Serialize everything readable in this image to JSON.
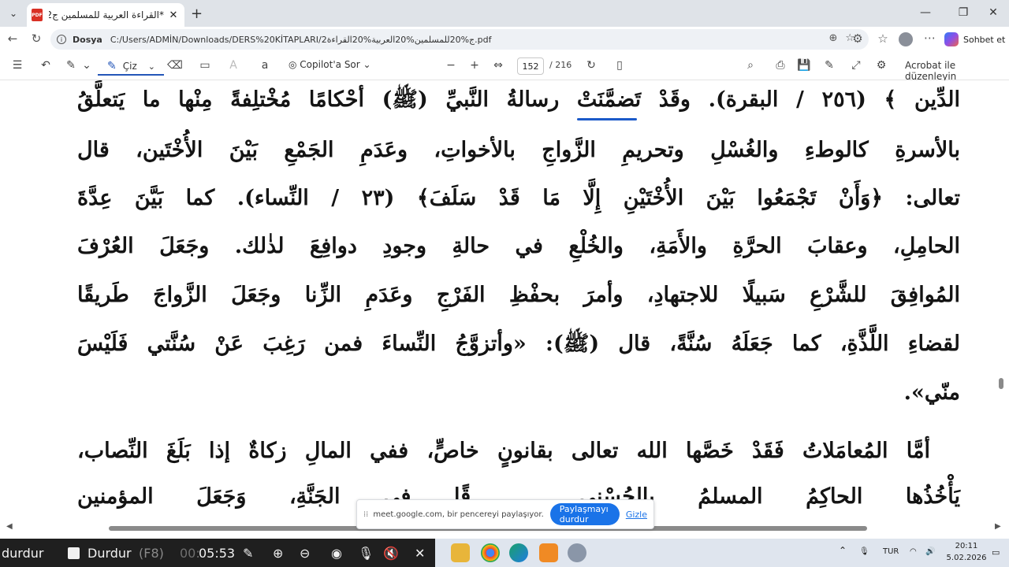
{
  "browser": {
    "tab_title": "*القراءة العربية للمسلمين ج2.pdf",
    "tab_favicon_label": "PDF",
    "address_scheme_label": "Dosya",
    "address_url": "C:/Users/ADMİN/Downloads/DERS%20KİTAPLARI/2ج%20للمسلمين%20العربية%20القراءة.pdf",
    "chat_label": "Sohbet et"
  },
  "pdf_toolbar": {
    "draw_label": "Çiz",
    "copilot_label": "Copilot'a Sor",
    "current_page": "152",
    "total_pages": "/ 216",
    "acrobat_label": "Acrobat ile düzenleyin"
  },
  "document": {
    "lines": [
      "الدِّين ﴾ (٢٥٦ / البقرة). وقَدْ تَضمَّنَتْ رسالةُ النَّبيِّ (ﷺ) أحْكامًا مُخْتلِفةً مِنْها ما يَتعلَّقُ",
      "بالأسرةِ كالوطءِ والغُسْلِ وتحريمِ الزَّواجِ بالأخواتِ، وعَدَمِ الجَمْعِ بَيْنَ الأُخْتَين، قال",
      "تعالى: ﴿وَأَنْ تَجْمَعُوا بَيْنَ الأُخْتَيْنِ إِلَّا مَا قَدْ سَلَفَ﴾ (٢٣ / النِّساء). كما بَيَّنَ عِدَّةَ",
      "الحامِلِ، وعقابَ الحرَّةِ والأَمَةِ، والخُلْعِ في حالةِ وجودِ دوافِعَ لذٰلك. وجَعَلَ العُرْفَ",
      "المُوافِقَ للشَّرْعِ سَبيلًا للاجتهادِ، وأمرَ بحفْظِ الفَرْجِ وعَدَمِ الزِّنا وجَعَلَ الزَّواجَ طَريقًا",
      "لقضاءِ اللَّذَّةِ، كما جَعَلَهُ سُنَّةً، قال (ﷺ): «وأتزوَّجُ النِّساءَ فمن رَغِبَ عَنْ سُنَّتي فَلَيْسَ",
      "منّي».",
      "أمَّا المُعامَلاتُ فَقَدْ خَصَّها الله تعالى بقانونٍ خاصٍّ، ففي المالِ زكاةٌ إذا بَلَغَ النِّصاب،",
      "يَأْخُذُها الحاكِمُ المسلمُ بالحُسْنى ... قًا في الجَنَّةِ، وَجَعَلَ المؤمنين"
    ]
  },
  "share_banner": {
    "message": "meet.google.com, bir pencereyi paylaşıyor.",
    "stop_label": "Paylaşmayı durdur",
    "hide_label": "Gizle"
  },
  "taskbar": {
    "rec_left_label": "durdur",
    "rec_stop_label": "Durdur",
    "rec_stop_shortcut": "(F8)",
    "rec_timer_prefix": "00:",
    "rec_timer": "05:53",
    "language": "TUR",
    "time": "20:11",
    "date": "5.02.2026"
  },
  "colors": {
    "ink_underline": "#1b59c9",
    "share_button": "#1a73e8",
    "recorder_bar": "#1f1f1f"
  }
}
